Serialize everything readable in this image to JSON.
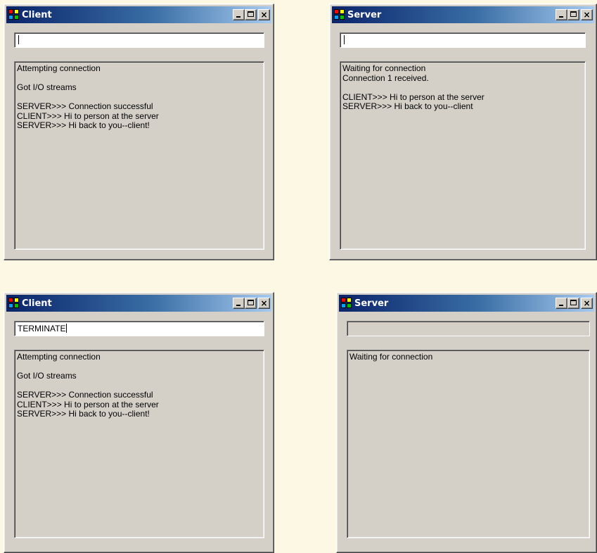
{
  "windows": [
    {
      "title": "Client",
      "input_value": "",
      "lines": [
        "Attempting connection",
        "",
        "Got I/O streams",
        "",
        "SERVER>>> Connection successful",
        "CLIENT>>> Hi to person at the server",
        "SERVER>>> Hi back to you--client!"
      ]
    },
    {
      "title": "Server",
      "input_value": "",
      "lines": [
        "Waiting for connection",
        "Connection 1 received.",
        "",
        "CLIENT>>> Hi to person at the server",
        "SERVER>>> Hi back to you--client"
      ]
    },
    {
      "title": "Client",
      "input_value": "TERMINATE",
      "lines": [
        "Attempting connection",
        "",
        "Got I/O streams",
        "",
        "SERVER>>> Connection successful",
        "CLIENT>>> Hi to person at the server",
        "SERVER>>> Hi back to you--client!"
      ]
    },
    {
      "title": "Server",
      "input_value": "",
      "lines": [
        "Waiting for connection"
      ]
    }
  ],
  "caption_buttons": {
    "minimize": "_",
    "maximize": "□",
    "close": "×"
  },
  "icons": {
    "app": "app-icon",
    "minimize": "minimize-icon",
    "maximize": "maximize-icon",
    "close": "close-icon"
  },
  "colors": {
    "background": "#fdf8e4",
    "window_face": "#d4d0c8",
    "title_start": "#0a246a",
    "title_end": "#a6caf0"
  }
}
